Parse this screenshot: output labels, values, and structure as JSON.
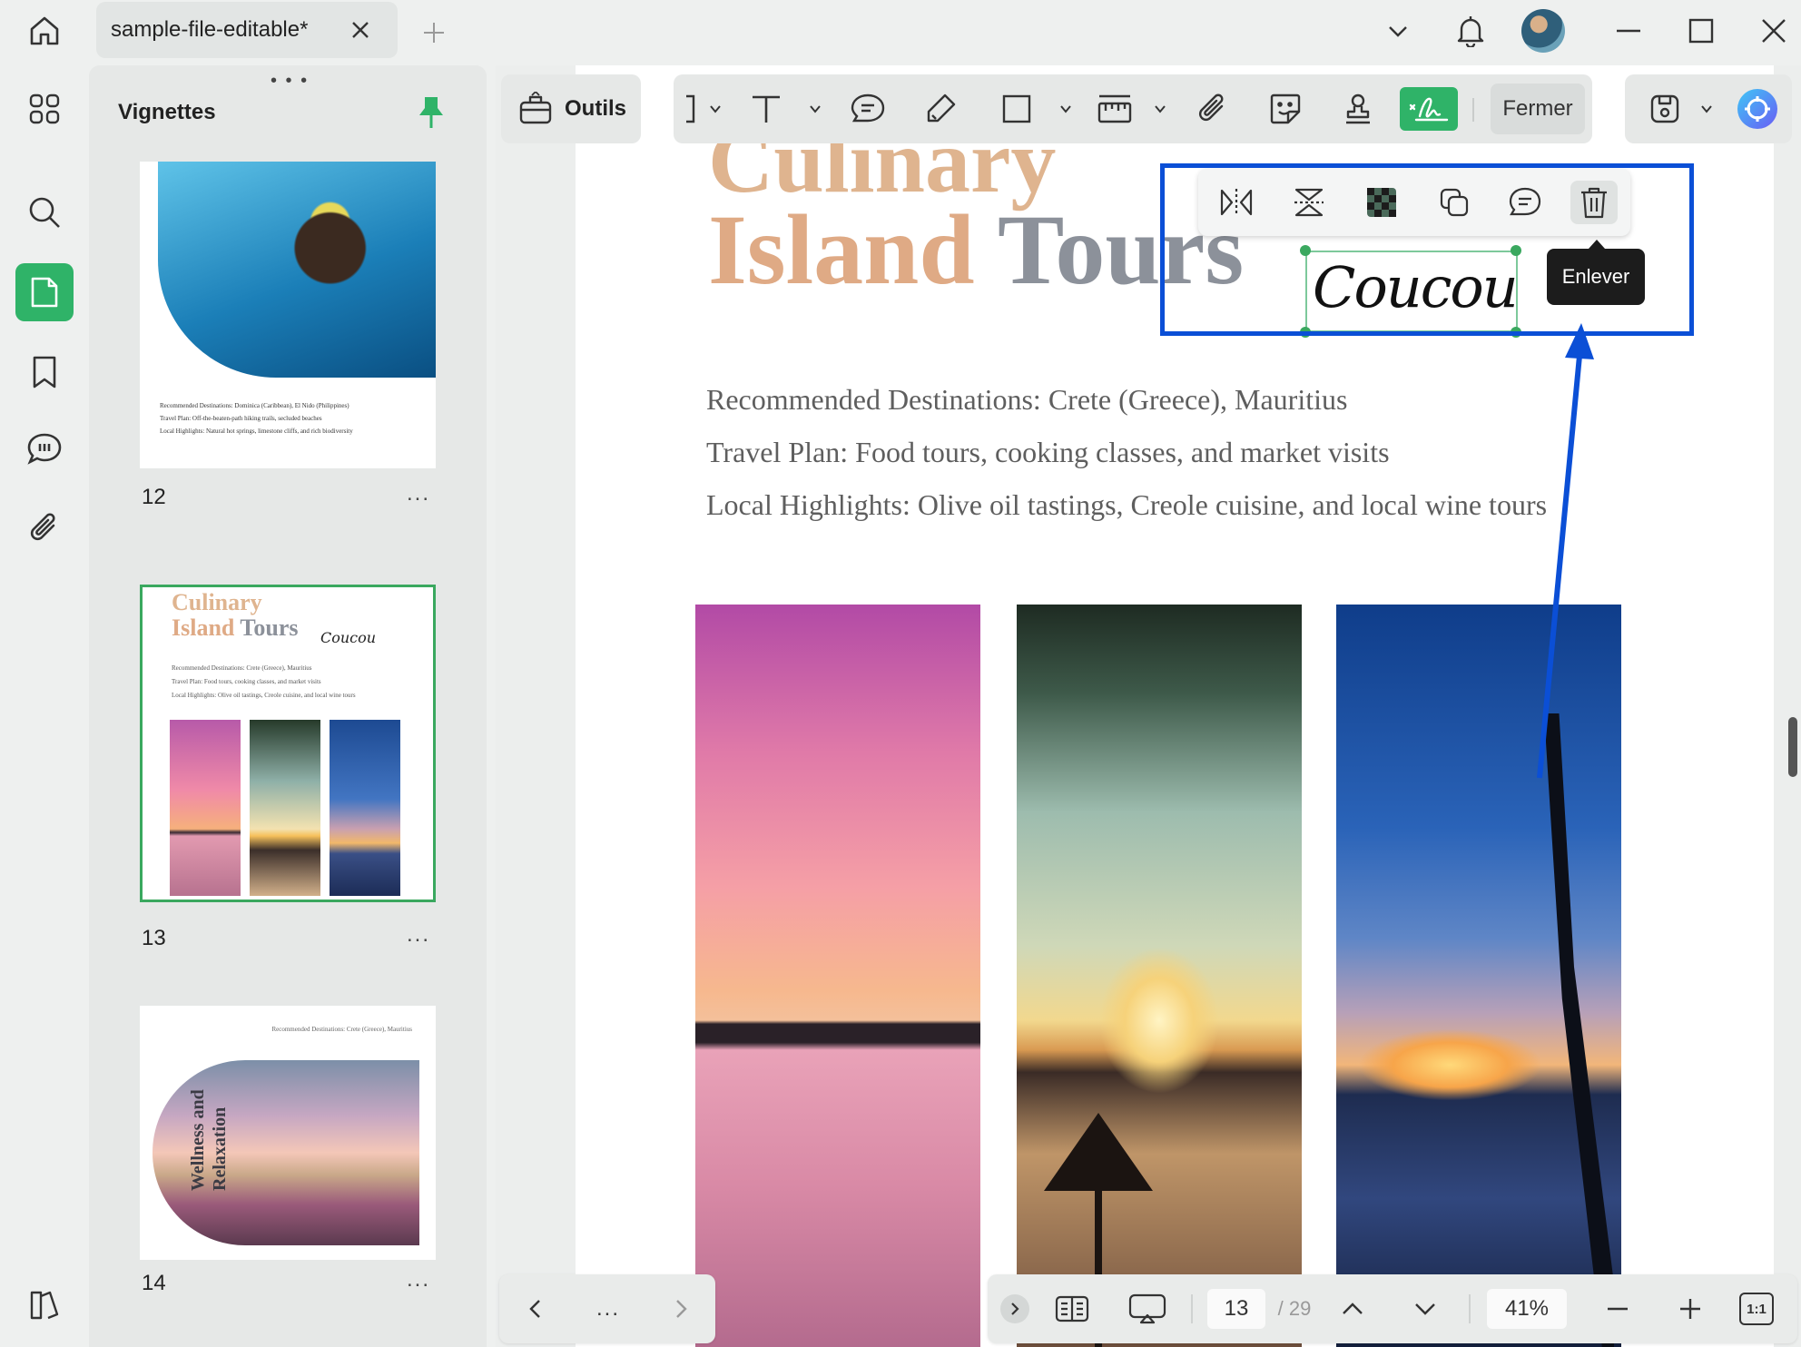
{
  "tab": {
    "title": "sample-file-editable*"
  },
  "thumbnails": {
    "title": "Vignettes",
    "grip": "• • •",
    "pages": [
      {
        "number": "12",
        "lines": [
          "Recommended Destinations: Dominica (Caribbean), El Nido (Philippines)",
          "Travel Plan: Off-the-beaten-path hiking trails, secluded beaches",
          "Local Highlights: Natural hot springs, limestone cliffs, and rich biodiversity"
        ]
      },
      {
        "number": "13",
        "title_line1": "Culinary",
        "title_line2a": "Island",
        "title_line2b": "Tours",
        "signature": "Coucou",
        "lines": [
          "Recommended Destinations: Crete (Greece), Mauritius",
          "Travel Plan: Food tours, cooking classes, and market visits",
          "Local Highlights: Olive oil tastings, Creole cuisine, and local wine tours"
        ]
      },
      {
        "number": "14",
        "header": "Recommended Destinations: Crete (Greece), Mauritius",
        "vertical_title_line1": "Wellness and",
        "vertical_title_line2": "Relaxation"
      }
    ],
    "more": "..."
  },
  "toolbar": {
    "tools_label": "Outils",
    "close_label": "Fermer"
  },
  "document": {
    "title_line1": "Culinary",
    "title_word1": "Island",
    "title_word2": "Tours",
    "signature": "Coucou",
    "lines": [
      "Recommended Destinations: Crete (Greece), Mauritius",
      "Travel Plan: Food tours, cooking classes, and market visits",
      "Local Highlights: Olive oil tastings, Creole cuisine, and local wine tours"
    ]
  },
  "tooltip": "Enlever",
  "statusbar": {
    "current_page": "13",
    "total_pages": "/ 29",
    "zoom": "41%",
    "ratio": "1:1",
    "more": "..."
  },
  "colors": {
    "accent": "#2fb368",
    "highlight": "#0b4fd6",
    "title_orange": "#dfaa85",
    "title_gray": "#8c919a"
  }
}
